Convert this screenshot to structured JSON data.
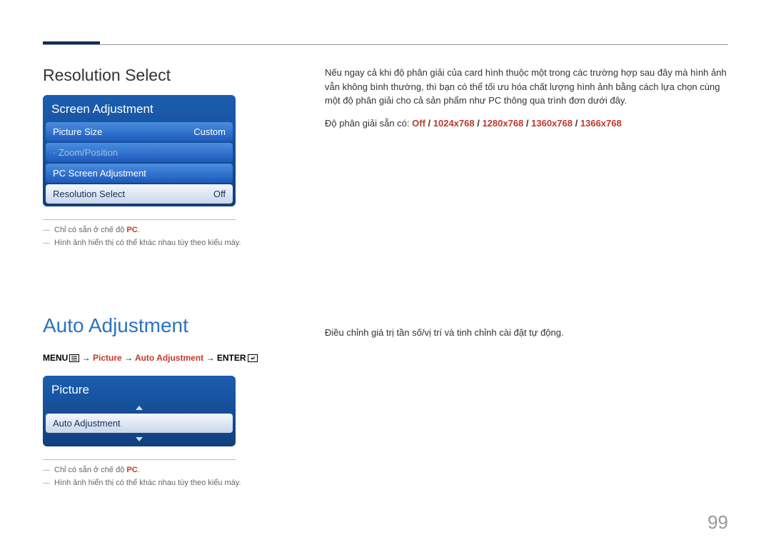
{
  "page_number": "99",
  "section1": {
    "title": "Resolution Select",
    "osd": {
      "header": "Screen Adjustment",
      "rows": [
        {
          "label": "Picture Size",
          "value": "Custom",
          "dim": false,
          "selected": false
        },
        {
          "label": "· Zoom/Position",
          "value": "",
          "dim": true,
          "selected": false
        },
        {
          "label": "PC Screen Adjustment",
          "value": "",
          "dim": false,
          "selected": false
        },
        {
          "label": "Resolution Select",
          "value": "Off",
          "dim": false,
          "selected": true
        }
      ]
    },
    "notes": {
      "n1_prefix": "Chỉ có sẵn ở chế độ ",
      "n1_pc": "PC",
      "n1_suffix": ".",
      "n2": "Hình ảnh hiển thị có thể khác nhau tùy theo kiểu máy."
    },
    "body": "Nếu ngay cả khi độ phân giải của card hình thuộc một trong các trường hợp sau đây mà hình ảnh vẫn không bình thường, thì bạn có thể tối ưu hóa chất lượng hình ảnh bằng cách lựa chọn cùng một độ phân giải cho cả sản phẩm như PC thông qua trình đơn dưới đây.",
    "avail_prefix": "Độ phân giải sẵn có: ",
    "options": [
      "Off",
      "1024x768",
      "1280x768",
      "1360x768",
      "1366x768"
    ],
    "slash": " / "
  },
  "section2": {
    "title": "Auto Adjustment",
    "nav": {
      "p1": "MENU",
      "arrow": " → ",
      "p2": "Picture",
      "p3": "Auto Adjustment",
      "p4": "ENTER"
    },
    "osd": {
      "header": "Picture",
      "row_label": "Auto Adjustment"
    },
    "notes": {
      "n1_prefix": "Chỉ có sẵn ở chế độ ",
      "n1_pc": "PC",
      "n1_suffix": ".",
      "n2": "Hình ảnh hiển thị có thể khác nhau tùy theo kiểu máy."
    },
    "body": "Điều chỉnh giá trị tần số/vị trí và tinh chỉnh cài đặt tự động."
  }
}
